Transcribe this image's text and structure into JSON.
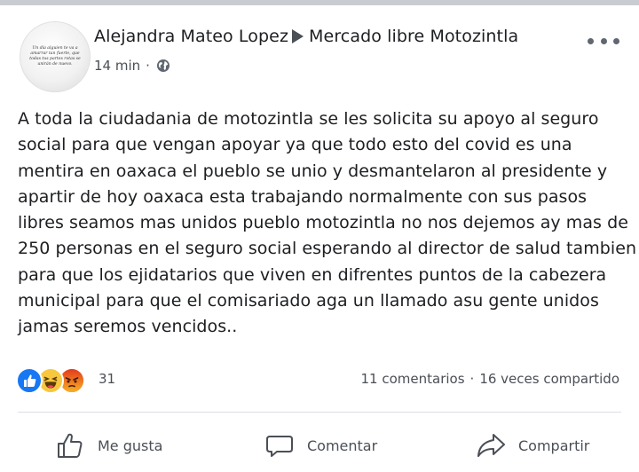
{
  "post": {
    "author": "Alejandra Mateo Lopez",
    "group": "Mercado libre Motozintla",
    "time": "14 min",
    "meta_separator": "·",
    "avatar_text": "Un día alguien te va a amarrar tan fuerte, que todas tus partes rotas se unirán de nuevo.",
    "icons": {
      "more": "more-options-icon",
      "audience": "globe-icon",
      "group_arrow": "right-triangle-icon"
    },
    "body_lines": [
      "A toda la ciudadania de motozintla se les solicita su apoyo al seguro",
      "social para que vengan apoyar ya que todo esto del covid es una",
      "mentira en oaxaca el pueblo se unio y desmantelaron al presidente y",
      "apartir de hoy oaxaca esta trabajando normalmente con sus pasos",
      "libres seamos mas unidos pueblo motozintla no nos dejemos ay mas de",
      "250 personas en el seguro social esperando al director de salud tambien",
      "para que los ejidatarios que viven en difrentes puntos de la cabezera",
      "municipal para que el comisariado aga un llamado asu gente unidos",
      "jamas seremos vencidos.."
    ]
  },
  "engagement": {
    "reaction_icons": [
      "like-reaction-icon",
      "haha-reaction-icon",
      "angry-reaction-icon"
    ],
    "reaction_count": "31",
    "comments": "11 comentarios",
    "separator": "·",
    "shares": "16 veces compartido"
  },
  "actions": {
    "like_label": "Me gusta",
    "comment_label": "Comentar",
    "share_label": "Compartir"
  },
  "colors": {
    "like_blue": "#1877f2",
    "haha_yellow": "#f7c73e",
    "angry_orange": "#e9710f",
    "text_primary": "#1c1e21",
    "text_secondary": "#4b4f56"
  }
}
